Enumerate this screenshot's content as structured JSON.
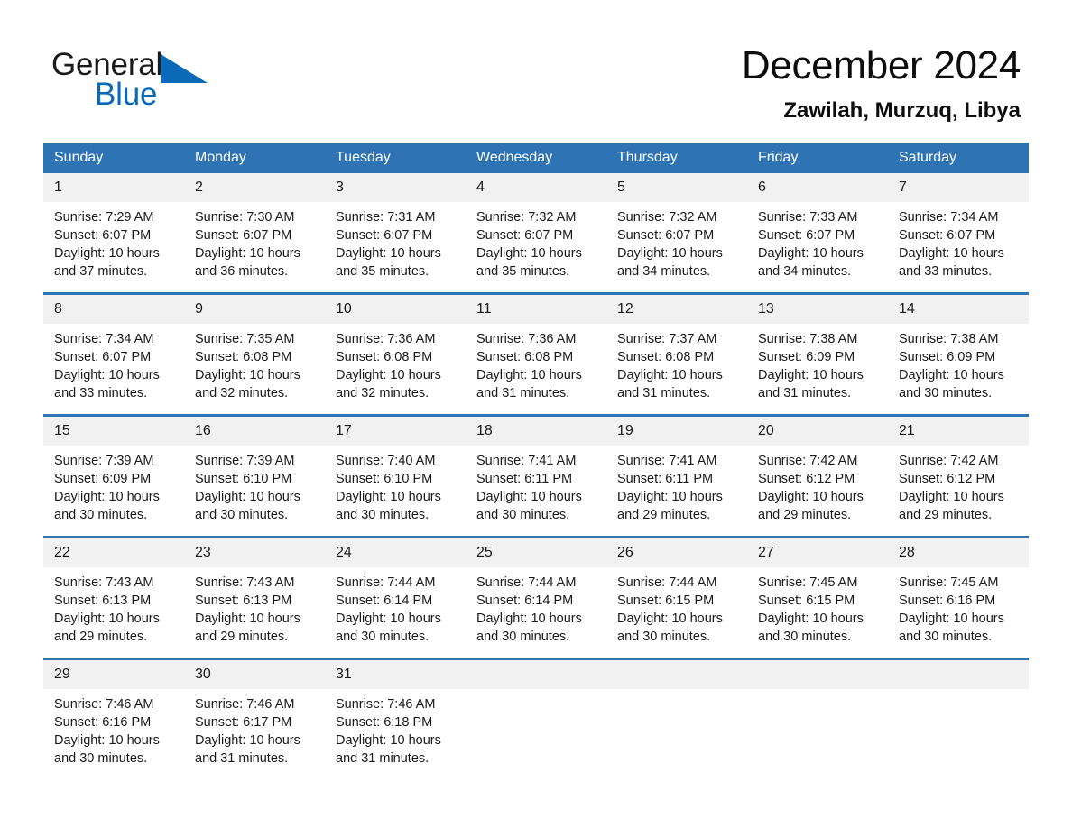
{
  "brand": {
    "name_part1": "General",
    "name_part2": "Blue",
    "triangle_color": "#0b6ab8"
  },
  "header": {
    "title": "December 2024",
    "location": "Zawilah, Murzuq, Libya"
  },
  "theme": {
    "header_blue": "#2e74b5",
    "daynum_band": "#f1f1f1",
    "text": "#1a1a1a"
  },
  "weekdays": [
    "Sunday",
    "Monday",
    "Tuesday",
    "Wednesday",
    "Thursday",
    "Friday",
    "Saturday"
  ],
  "weeks": [
    [
      {
        "day": "1",
        "sunrise": "Sunrise: 7:29 AM",
        "sunset": "Sunset: 6:07 PM",
        "daylight_line1": "Daylight: 10 hours",
        "daylight_line2": "and 37 minutes."
      },
      {
        "day": "2",
        "sunrise": "Sunrise: 7:30 AM",
        "sunset": "Sunset: 6:07 PM",
        "daylight_line1": "Daylight: 10 hours",
        "daylight_line2": "and 36 minutes."
      },
      {
        "day": "3",
        "sunrise": "Sunrise: 7:31 AM",
        "sunset": "Sunset: 6:07 PM",
        "daylight_line1": "Daylight: 10 hours",
        "daylight_line2": "and 35 minutes."
      },
      {
        "day": "4",
        "sunrise": "Sunrise: 7:32 AM",
        "sunset": "Sunset: 6:07 PM",
        "daylight_line1": "Daylight: 10 hours",
        "daylight_line2": "and 35 minutes."
      },
      {
        "day": "5",
        "sunrise": "Sunrise: 7:32 AM",
        "sunset": "Sunset: 6:07 PM",
        "daylight_line1": "Daylight: 10 hours",
        "daylight_line2": "and 34 minutes."
      },
      {
        "day": "6",
        "sunrise": "Sunrise: 7:33 AM",
        "sunset": "Sunset: 6:07 PM",
        "daylight_line1": "Daylight: 10 hours",
        "daylight_line2": "and 34 minutes."
      },
      {
        "day": "7",
        "sunrise": "Sunrise: 7:34 AM",
        "sunset": "Sunset: 6:07 PM",
        "daylight_line1": "Daylight: 10 hours",
        "daylight_line2": "and 33 minutes."
      }
    ],
    [
      {
        "day": "8",
        "sunrise": "Sunrise: 7:34 AM",
        "sunset": "Sunset: 6:07 PM",
        "daylight_line1": "Daylight: 10 hours",
        "daylight_line2": "and 33 minutes."
      },
      {
        "day": "9",
        "sunrise": "Sunrise: 7:35 AM",
        "sunset": "Sunset: 6:08 PM",
        "daylight_line1": "Daylight: 10 hours",
        "daylight_line2": "and 32 minutes."
      },
      {
        "day": "10",
        "sunrise": "Sunrise: 7:36 AM",
        "sunset": "Sunset: 6:08 PM",
        "daylight_line1": "Daylight: 10 hours",
        "daylight_line2": "and 32 minutes."
      },
      {
        "day": "11",
        "sunrise": "Sunrise: 7:36 AM",
        "sunset": "Sunset: 6:08 PM",
        "daylight_line1": "Daylight: 10 hours",
        "daylight_line2": "and 31 minutes."
      },
      {
        "day": "12",
        "sunrise": "Sunrise: 7:37 AM",
        "sunset": "Sunset: 6:08 PM",
        "daylight_line1": "Daylight: 10 hours",
        "daylight_line2": "and 31 minutes."
      },
      {
        "day": "13",
        "sunrise": "Sunrise: 7:38 AM",
        "sunset": "Sunset: 6:09 PM",
        "daylight_line1": "Daylight: 10 hours",
        "daylight_line2": "and 31 minutes."
      },
      {
        "day": "14",
        "sunrise": "Sunrise: 7:38 AM",
        "sunset": "Sunset: 6:09 PM",
        "daylight_line1": "Daylight: 10 hours",
        "daylight_line2": "and 30 minutes."
      }
    ],
    [
      {
        "day": "15",
        "sunrise": "Sunrise: 7:39 AM",
        "sunset": "Sunset: 6:09 PM",
        "daylight_line1": "Daylight: 10 hours",
        "daylight_line2": "and 30 minutes."
      },
      {
        "day": "16",
        "sunrise": "Sunrise: 7:39 AM",
        "sunset": "Sunset: 6:10 PM",
        "daylight_line1": "Daylight: 10 hours",
        "daylight_line2": "and 30 minutes."
      },
      {
        "day": "17",
        "sunrise": "Sunrise: 7:40 AM",
        "sunset": "Sunset: 6:10 PM",
        "daylight_line1": "Daylight: 10 hours",
        "daylight_line2": "and 30 minutes."
      },
      {
        "day": "18",
        "sunrise": "Sunrise: 7:41 AM",
        "sunset": "Sunset: 6:11 PM",
        "daylight_line1": "Daylight: 10 hours",
        "daylight_line2": "and 30 minutes."
      },
      {
        "day": "19",
        "sunrise": "Sunrise: 7:41 AM",
        "sunset": "Sunset: 6:11 PM",
        "daylight_line1": "Daylight: 10 hours",
        "daylight_line2": "and 29 minutes."
      },
      {
        "day": "20",
        "sunrise": "Sunrise: 7:42 AM",
        "sunset": "Sunset: 6:12 PM",
        "daylight_line1": "Daylight: 10 hours",
        "daylight_line2": "and 29 minutes."
      },
      {
        "day": "21",
        "sunrise": "Sunrise: 7:42 AM",
        "sunset": "Sunset: 6:12 PM",
        "daylight_line1": "Daylight: 10 hours",
        "daylight_line2": "and 29 minutes."
      }
    ],
    [
      {
        "day": "22",
        "sunrise": "Sunrise: 7:43 AM",
        "sunset": "Sunset: 6:13 PM",
        "daylight_line1": "Daylight: 10 hours",
        "daylight_line2": "and 29 minutes."
      },
      {
        "day": "23",
        "sunrise": "Sunrise: 7:43 AM",
        "sunset": "Sunset: 6:13 PM",
        "daylight_line1": "Daylight: 10 hours",
        "daylight_line2": "and 29 minutes."
      },
      {
        "day": "24",
        "sunrise": "Sunrise: 7:44 AM",
        "sunset": "Sunset: 6:14 PM",
        "daylight_line1": "Daylight: 10 hours",
        "daylight_line2": "and 30 minutes."
      },
      {
        "day": "25",
        "sunrise": "Sunrise: 7:44 AM",
        "sunset": "Sunset: 6:14 PM",
        "daylight_line1": "Daylight: 10 hours",
        "daylight_line2": "and 30 minutes."
      },
      {
        "day": "26",
        "sunrise": "Sunrise: 7:44 AM",
        "sunset": "Sunset: 6:15 PM",
        "daylight_line1": "Daylight: 10 hours",
        "daylight_line2": "and 30 minutes."
      },
      {
        "day": "27",
        "sunrise": "Sunrise: 7:45 AM",
        "sunset": "Sunset: 6:15 PM",
        "daylight_line1": "Daylight: 10 hours",
        "daylight_line2": "and 30 minutes."
      },
      {
        "day": "28",
        "sunrise": "Sunrise: 7:45 AM",
        "sunset": "Sunset: 6:16 PM",
        "daylight_line1": "Daylight: 10 hours",
        "daylight_line2": "and 30 minutes."
      }
    ],
    [
      {
        "day": "29",
        "sunrise": "Sunrise: 7:46 AM",
        "sunset": "Sunset: 6:16 PM",
        "daylight_line1": "Daylight: 10 hours",
        "daylight_line2": "and 30 minutes."
      },
      {
        "day": "30",
        "sunrise": "Sunrise: 7:46 AM",
        "sunset": "Sunset: 6:17 PM",
        "daylight_line1": "Daylight: 10 hours",
        "daylight_line2": "and 31 minutes."
      },
      {
        "day": "31",
        "sunrise": "Sunrise: 7:46 AM",
        "sunset": "Sunset: 6:18 PM",
        "daylight_line1": "Daylight: 10 hours",
        "daylight_line2": "and 31 minutes."
      },
      {
        "day": "",
        "sunrise": "",
        "sunset": "",
        "daylight_line1": "",
        "daylight_line2": ""
      },
      {
        "day": "",
        "sunrise": "",
        "sunset": "",
        "daylight_line1": "",
        "daylight_line2": ""
      },
      {
        "day": "",
        "sunrise": "",
        "sunset": "",
        "daylight_line1": "",
        "daylight_line2": ""
      },
      {
        "day": "",
        "sunrise": "",
        "sunset": "",
        "daylight_line1": "",
        "daylight_line2": ""
      }
    ]
  ]
}
